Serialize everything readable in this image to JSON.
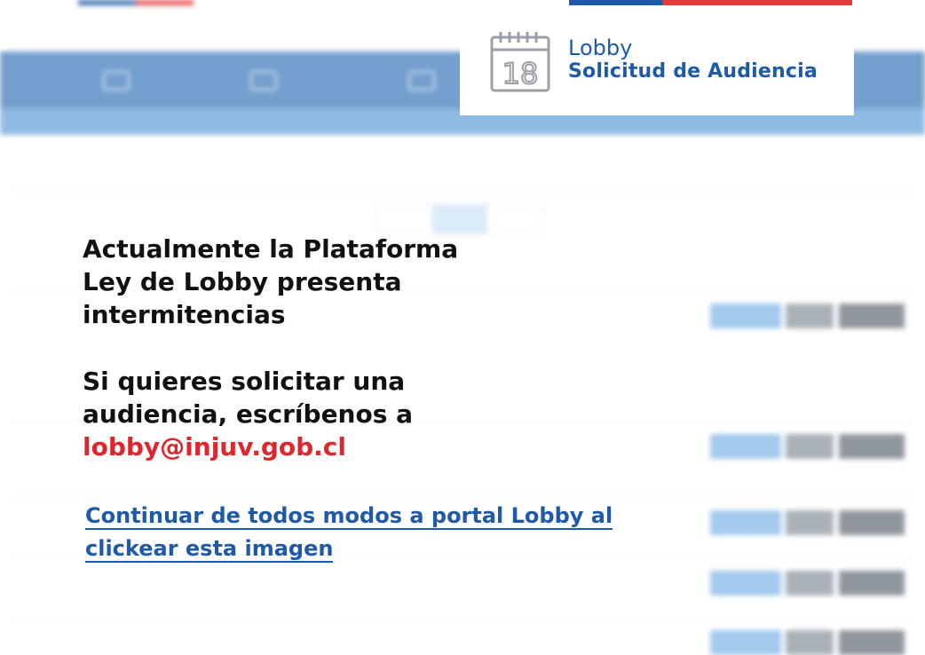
{
  "logo": {
    "line1": "Lobby",
    "line2": "Solicitud de Audiencia",
    "calendar_number": "18",
    "icon": "calendar-icon"
  },
  "message": {
    "line1": "Actualmente la Plataforma",
    "line2": "Ley de Lobby presenta",
    "line3": "intermitencias",
    "line4": "Si quieres solicitar una",
    "line5": "audiencia, escríbenos a",
    "email": "lobby@injuv.gob.cl"
  },
  "continue_link": {
    "line1": "Continuar de todos modos a portal Lobby al",
    "line2": "clickear esta imagen"
  },
  "colors": {
    "text": "#111111",
    "email": "#e0262c",
    "link": "#1f5aa8",
    "nav": "#5b8fc6",
    "subnav": "#7cb0de"
  }
}
